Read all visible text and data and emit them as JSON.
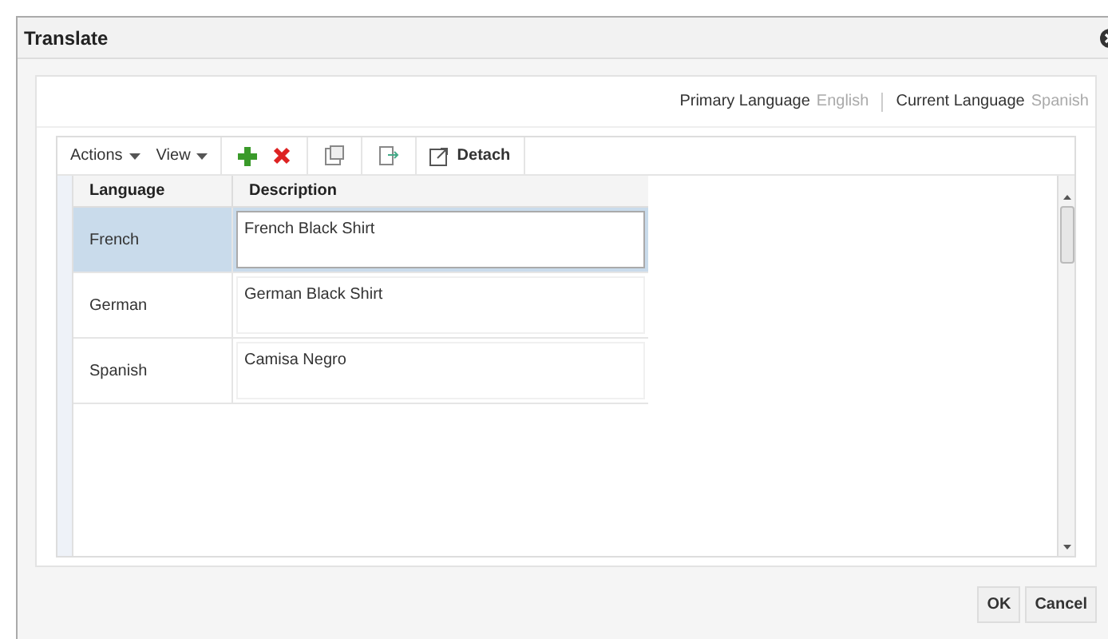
{
  "window": {
    "title": "Translate"
  },
  "languages": {
    "primary_label": "Primary Language",
    "primary_value": "English",
    "current_label": "Current Language",
    "current_value": "Spanish"
  },
  "toolbar": {
    "menus": [
      "Actions",
      "View"
    ],
    "detach": "Detach"
  },
  "table": {
    "columns": [
      "Language",
      "Description"
    ],
    "rows": [
      {
        "language": "French",
        "description": "French Black Shirt",
        "selected": true
      },
      {
        "language": "German",
        "description": "German Black Shirt",
        "selected": false
      },
      {
        "language": "Spanish",
        "description": "Camisa Negro",
        "selected": false
      }
    ]
  },
  "buttons": [
    "OK",
    "Cancel"
  ]
}
